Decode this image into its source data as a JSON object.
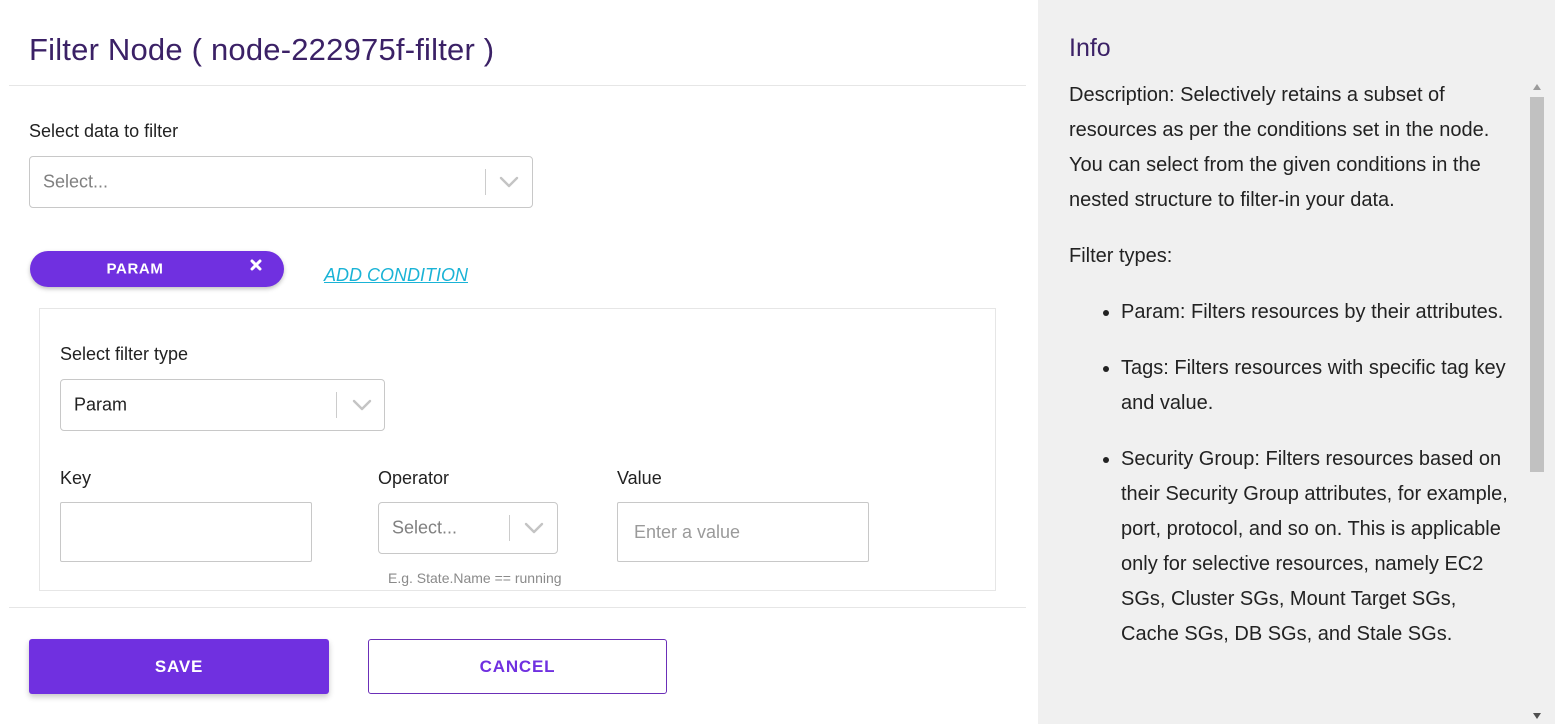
{
  "header": {
    "title": "Filter Node ( node-222975f-filter )"
  },
  "data_select": {
    "label": "Select data to filter",
    "placeholder": "Select..."
  },
  "condition_tab": {
    "label": "PARAM"
  },
  "add_condition": {
    "label": "ADD CONDITION"
  },
  "filter_type": {
    "label": "Select filter type",
    "value": "Param"
  },
  "key_field": {
    "label": "Key",
    "value": ""
  },
  "operator_field": {
    "label": "Operator",
    "placeholder": "Select...",
    "hint": "E.g. State.Name == running"
  },
  "value_field": {
    "label": "Value",
    "placeholder": "Enter a value"
  },
  "actions": {
    "save_label": "SAVE",
    "cancel_label": "CANCEL"
  },
  "info": {
    "title": "Info",
    "description": "Description: Selectively retains a subset of resources as per the conditions set in the node. You can select from the given conditions in the nested structure to filter-in your data.",
    "filter_types_heading": "Filter types:",
    "items": [
      "Param: Filters resources by their attributes.",
      "Tags: Filters resources with specific tag key and value.",
      "Security Group: Filters resources based on their Security Group attributes, for example, port, protocol, and so on. This is applicable only for selective resources, namely EC2 SGs, Cluster SGs, Mount Target SGs, Cache SGs, DB SGs, and Stale SGs."
    ]
  },
  "colors": {
    "accent": "#7030e0",
    "title": "#3b2166",
    "link": "#1ab3d6",
    "sidebar_bg": "#f0f0f0"
  },
  "icons": {
    "chevron": "chevron-down-icon",
    "remove": "close-icon"
  }
}
